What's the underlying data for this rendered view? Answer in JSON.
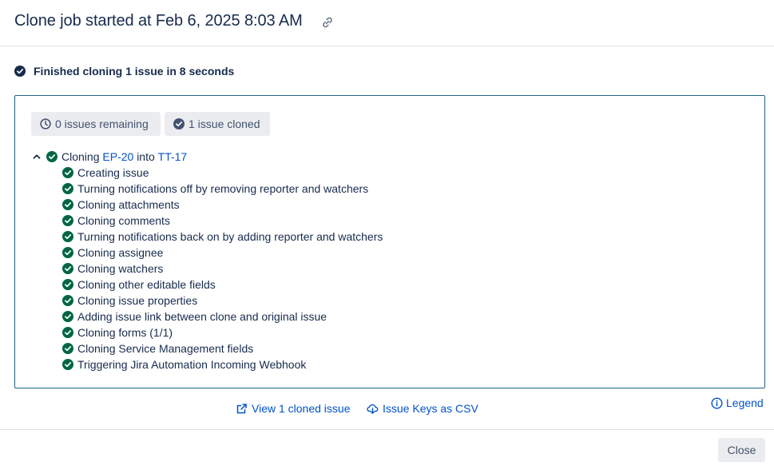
{
  "header": {
    "title": "Clone job started at Feb 6, 2025 8:03 AM",
    "link_icon": "link-icon"
  },
  "summary": {
    "text": "Finished cloning 1 issue in 8 seconds",
    "icon": "check-circle-icon"
  },
  "status_pills": {
    "remaining": "0 issues remaining",
    "cloned": "1 issue cloned"
  },
  "tree": {
    "prefix": "Cloning",
    "source_key": "EP-20",
    "middle": "into",
    "target_key": "TT-17",
    "steps": [
      "Creating issue",
      "Turning notifications off by removing reporter and watchers",
      "Cloning attachments",
      "Cloning comments",
      "Turning notifications back on by adding reporter and watchers",
      "Cloning assignee",
      "Cloning watchers",
      "Cloning other editable fields",
      "Cloning issue properties",
      "Adding issue link between clone and original issue",
      "Cloning forms (1/1)",
      "Cloning Service Management fields",
      "Triggering Jira Automation Incoming Webhook"
    ]
  },
  "footer": {
    "view_link": "View 1 cloned issue",
    "csv_link": "Issue Keys as CSV",
    "legend": "Legend",
    "close": "Close"
  },
  "colors": {
    "success": "#006644",
    "link": "#0052cc",
    "text": "#172b4d",
    "panel_border": "#1a6485"
  }
}
